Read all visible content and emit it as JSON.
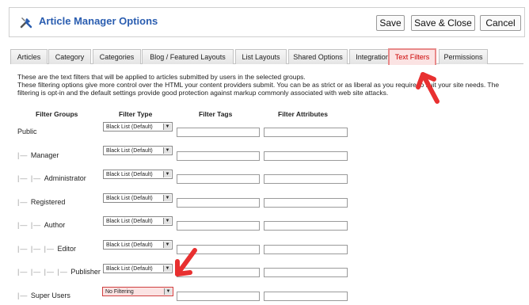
{
  "header": {
    "icon": "tools-icon",
    "title": "Article Manager Options",
    "buttons": {
      "save": "Save",
      "save_close": "Save & Close",
      "cancel": "Cancel"
    }
  },
  "tabs": [
    {
      "label": "Articles"
    },
    {
      "label": "Category"
    },
    {
      "label": "Categories"
    },
    {
      "label": "Blog / Featured Layouts"
    },
    {
      "label": "List Layouts"
    },
    {
      "label": "Shared Options"
    },
    {
      "label": "Integration"
    },
    {
      "label": "Text Filters",
      "active": true
    },
    {
      "label": "Permissions"
    }
  ],
  "description": {
    "line1": "These are the text filters that will be applied to articles submitted by users in the selected groups.",
    "line2": "These filtering options give more control over the HTML your content providers submit. You can be as strict or as liberal as you require to suit your site needs. The filtering is opt-in and the default settings provide good protection against markup commonly associated with web site attacks."
  },
  "table": {
    "headers": {
      "groups": "Filter Groups",
      "type": "Filter Type",
      "tags": "Filter Tags",
      "attrs": "Filter Attributes"
    },
    "rows": [
      {
        "prefix": "",
        "group": "Public",
        "type": "Black List (Default)"
      },
      {
        "prefix": "|— ",
        "group": "Manager",
        "type": "Black List (Default)"
      },
      {
        "prefix": "|— |— ",
        "group": "Administrator",
        "type": "Black List (Default)"
      },
      {
        "prefix": "|— ",
        "group": "Registered",
        "type": "Black List (Default)"
      },
      {
        "prefix": "|— |— ",
        "group": "Author",
        "type": "Black List (Default)"
      },
      {
        "prefix": "|— |— |— ",
        "group": "Editor",
        "type": "Black List (Default)"
      },
      {
        "prefix": "|— |— |— |— ",
        "group": "Publisher",
        "type": "Black List (Default)"
      },
      {
        "prefix": "|— ",
        "group": "Super Users",
        "type": "No Filtering"
      }
    ]
  },
  "colors": {
    "accent": "#2a5db0",
    "highlight": "#e83030",
    "active_tab_bg": "#fbe3e3"
  }
}
